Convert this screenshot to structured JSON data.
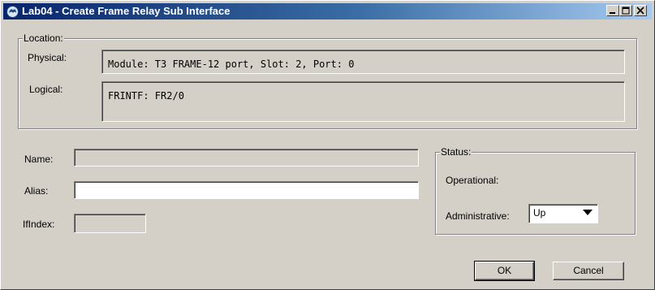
{
  "window": {
    "title": "Lab04 - Create Frame Relay Sub Interface"
  },
  "location": {
    "legend": "Location:",
    "physical_label": "Physical:",
    "physical_value": "Module: T3 FRAME-12 port, Slot: 2, Port: 0",
    "logical_label": "Logical:",
    "logical_value": "FRINTF: FR2/0"
  },
  "form": {
    "name_label": "Name:",
    "name_value": "",
    "alias_label": "Alias:",
    "alias_value": "",
    "ifindex_label": "IfIndex:",
    "ifindex_value": ""
  },
  "status": {
    "legend": "Status:",
    "operational_label": "Operational:",
    "operational_value": "",
    "administrative_label": "Administrative:",
    "administrative_value": "Up"
  },
  "buttons": {
    "ok_label": "OK",
    "cancel_label": "Cancel"
  },
  "icons": {
    "app": "application-icon",
    "minimize": "minimize-icon",
    "maximize": "maximize-icon",
    "close": "close-icon",
    "dropdown": "chevron-down-icon"
  }
}
